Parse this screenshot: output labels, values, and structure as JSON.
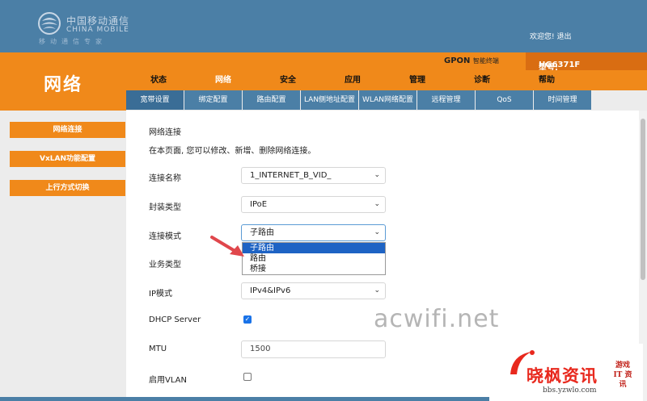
{
  "brand": {
    "name_cn": "中国移动通信",
    "name_en": "CHINA MOBILE",
    "slogan": "移动通信专家"
  },
  "header": {
    "welcome": "欢迎您!",
    "logout": "退出",
    "gpon": "GPON",
    "gpon_suffix": "智能终端",
    "model_label": "型号:",
    "model_value": "HG6371F",
    "section_title": "网络"
  },
  "main_nav": [
    "状态",
    "网络",
    "安全",
    "应用",
    "管理",
    "诊断",
    "帮助"
  ],
  "sub_nav": [
    "宽带设置",
    "绑定配置",
    "路由配置",
    "LAN侧地址配置",
    "WLAN网络配置",
    "远程管理",
    "QoS",
    "时间管理"
  ],
  "sidebar": [
    "网络连接",
    "VxLAN功能配置",
    "上行方式切换"
  ],
  "form": {
    "heading": "网络连接",
    "description": "在本页面, 您可以修改、新增、删除网络连接。",
    "fields": {
      "connection_name": {
        "label": "连接名称",
        "value": "1_INTERNET_B_VID_"
      },
      "encapsulation": {
        "label": "封装类型",
        "value": "IPoE"
      },
      "connection_mode": {
        "label": "连接模式",
        "value": "子路由",
        "options": [
          "子路由",
          "路由",
          "桥接"
        ]
      },
      "service_type": {
        "label": "业务类型"
      },
      "ip_mode": {
        "label": "IP模式",
        "value": "IPv4&IPv6"
      },
      "dhcp_server": {
        "label": "DHCP Server",
        "checked": true
      },
      "mtu": {
        "label": "MTU",
        "value": "1500"
      },
      "enable_vlan": {
        "label": "启用VLAN",
        "checked": false
      }
    }
  },
  "watermark": {
    "site": "acwifi.net",
    "stamp_title": "晓枫资讯",
    "stamp_url": "bbs.yzwlo.com",
    "stamp_side": "游戏 IT 资讯"
  },
  "colors": {
    "header_blue": "#4b7fa6",
    "accent_orange": "#f0891a",
    "selected_option": "#1e63c4",
    "arrow_red": "#e0474c"
  }
}
